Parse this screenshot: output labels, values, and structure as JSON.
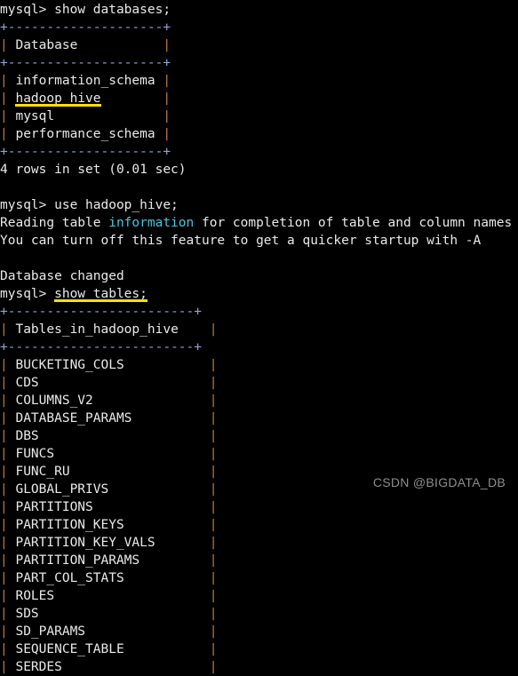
{
  "terminal": {
    "prompt": "mysql> ",
    "colors": {
      "background": "#000000",
      "foreground": "#e6e6e6",
      "pipe": "#c07a3e",
      "rule": "#8aa4d6",
      "cyan": "#43c7de",
      "highlight": "#ffe000",
      "watermark": "#8d8d8d"
    },
    "lines": [
      {
        "id": "cmd-show-databases",
        "kind": "command",
        "prompt": "mysql> ",
        "command": "show databases;"
      },
      {
        "id": "db-border-top",
        "kind": "rule",
        "text": "+--------------------+"
      },
      {
        "id": "db-header-row",
        "kind": "row",
        "value": "Database",
        "pad": "          "
      },
      {
        "id": "db-border-mid",
        "kind": "rule",
        "text": "+--------------------+"
      },
      {
        "id": "db-row-1",
        "kind": "row",
        "value": "information_schema",
        "pad": ""
      },
      {
        "id": "db-row-2",
        "kind": "row-highlight",
        "value": "hadoop_hive",
        "pad": "       "
      },
      {
        "id": "db-row-3",
        "kind": "row",
        "value": "mysql",
        "pad": "             "
      },
      {
        "id": "db-row-4",
        "kind": "row",
        "value": "performance_schema",
        "pad": ""
      },
      {
        "id": "db-border-bottom",
        "kind": "rule",
        "text": "+--------------------+"
      },
      {
        "id": "db-result-count",
        "kind": "text",
        "text": "4 rows in set (0.01 sec)"
      },
      {
        "id": "blank-1",
        "kind": "blank",
        "text": ""
      },
      {
        "id": "cmd-use-db",
        "kind": "command",
        "prompt": "mysql> ",
        "command": "use hadoop_hive;"
      },
      {
        "id": "notice-reading-table",
        "kind": "notice",
        "pre": "Reading table ",
        "emphasis": "information",
        "post": " for completion of table and column names"
      },
      {
        "id": "notice-turn-off",
        "kind": "text",
        "text": "You can turn off this feature to get a quicker startup with -A"
      },
      {
        "id": "blank-2",
        "kind": "blank",
        "text": ""
      },
      {
        "id": "status-database-changed",
        "kind": "text",
        "text": "Database changed"
      },
      {
        "id": "cmd-show-tables",
        "kind": "command-highlight",
        "prompt": "mysql> ",
        "command": "show tables;"
      },
      {
        "id": "tbl-border-top",
        "kind": "rule",
        "text": "+------------------------+"
      },
      {
        "id": "tbl-header-row",
        "kind": "row",
        "value": "Tables_in_hadoop_hive",
        "pad": "   "
      },
      {
        "id": "tbl-border-mid",
        "kind": "rule",
        "text": "+------------------------+"
      },
      {
        "id": "tbl-row-1",
        "kind": "row",
        "value": "BUCKETING_COLS",
        "pad": "          "
      },
      {
        "id": "tbl-row-2",
        "kind": "row",
        "value": "CDS",
        "pad": "                     "
      },
      {
        "id": "tbl-row-3",
        "kind": "row",
        "value": "COLUMNS_V2",
        "pad": "              "
      },
      {
        "id": "tbl-row-4",
        "kind": "row",
        "value": "DATABASE_PARAMS",
        "pad": "         "
      },
      {
        "id": "tbl-row-5",
        "kind": "row",
        "value": "DBS",
        "pad": "                     "
      },
      {
        "id": "tbl-row-6",
        "kind": "row",
        "value": "FUNCS",
        "pad": "                   "
      },
      {
        "id": "tbl-row-7",
        "kind": "row",
        "value": "FUNC_RU",
        "pad": "                 "
      },
      {
        "id": "tbl-row-8",
        "kind": "row",
        "value": "GLOBAL_PRIVS",
        "pad": "            "
      },
      {
        "id": "tbl-row-9",
        "kind": "row",
        "value": "PARTITIONS",
        "pad": "              "
      },
      {
        "id": "tbl-row-10",
        "kind": "row",
        "value": "PARTITION_KEYS",
        "pad": "          "
      },
      {
        "id": "tbl-row-11",
        "kind": "row",
        "value": "PARTITION_KEY_VALS",
        "pad": "      "
      },
      {
        "id": "tbl-row-12",
        "kind": "row",
        "value": "PARTITION_PARAMS",
        "pad": "        "
      },
      {
        "id": "tbl-row-13",
        "kind": "row",
        "value": "PART_COL_STATS",
        "pad": "          "
      },
      {
        "id": "tbl-row-14",
        "kind": "row",
        "value": "ROLES",
        "pad": "                   "
      },
      {
        "id": "tbl-row-15",
        "kind": "row",
        "value": "SDS",
        "pad": "                     "
      },
      {
        "id": "tbl-row-16",
        "kind": "row",
        "value": "SD_PARAMS",
        "pad": "               "
      },
      {
        "id": "tbl-row-17",
        "kind": "row",
        "value": "SEQUENCE_TABLE",
        "pad": "          "
      },
      {
        "id": "tbl-row-18",
        "kind": "row",
        "value": "SERDES",
        "pad": "                  "
      }
    ]
  },
  "watermark": {
    "text": "CSDN @BIGDATA_DB"
  }
}
